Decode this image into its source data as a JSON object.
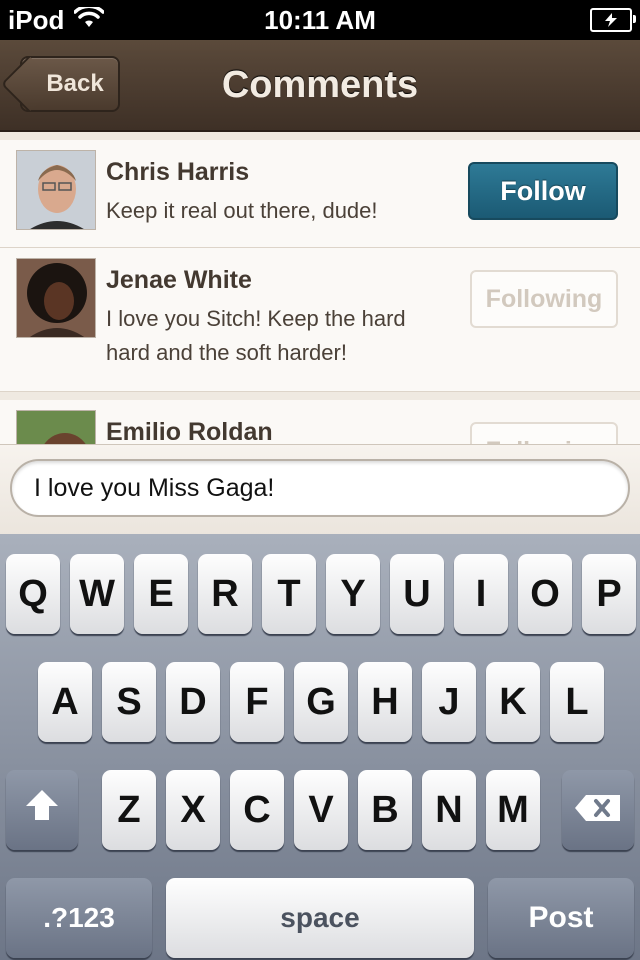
{
  "status_bar": {
    "carrier": "iPod",
    "time": "10:11 AM",
    "wifi_icon": "wifi-icon",
    "battery_icon": "battery-charging-icon"
  },
  "nav": {
    "back_label": "Back",
    "title": "Comments"
  },
  "comments": [
    {
      "name": "Chris Harris",
      "text": "Keep it real out there, dude!",
      "button": "Follow",
      "button_state": "follow"
    },
    {
      "name": "Jenae White",
      "text": "I love you Sitch! Keep the hard hard and the soft harder!",
      "button": "Following",
      "button_state": "following"
    },
    {
      "name": "Emilio Roldan",
      "text": "",
      "button": "Following",
      "button_state": "following"
    }
  ],
  "compose": {
    "value": "I love you Miss Gaga!"
  },
  "keyboard": {
    "row1": [
      "Q",
      "W",
      "E",
      "R",
      "T",
      "Y",
      "U",
      "I",
      "O",
      "P"
    ],
    "row2": [
      "A",
      "S",
      "D",
      "F",
      "G",
      "H",
      "J",
      "K",
      "L"
    ],
    "row3": [
      "Z",
      "X",
      "C",
      "V",
      "B",
      "N",
      "M"
    ],
    "shift_icon": "shift-arrow-icon",
    "delete_icon": "backspace-icon",
    "numbers_label": ".?123",
    "space_label": "space",
    "post_label": "Post"
  },
  "colors": {
    "nav_brown": "#4a3a2d",
    "follow_teal": "#1b5a74",
    "keyboard_gray": "#8a92a1"
  }
}
